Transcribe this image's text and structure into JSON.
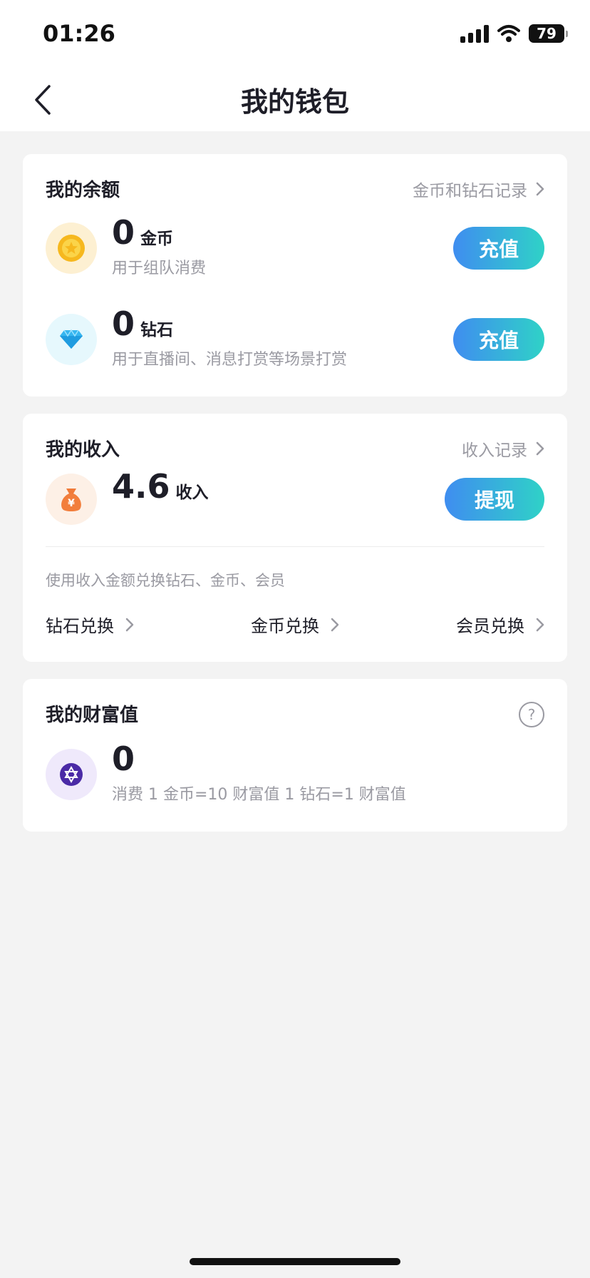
{
  "status_bar": {
    "time": "01:26",
    "battery": "79"
  },
  "header": {
    "title": "我的钱包"
  },
  "balance": {
    "title": "我的余额",
    "record_link": "金币和钻石记录",
    "coin": {
      "amount": "0",
      "unit": "金币",
      "desc": "用于组队消费",
      "button": "充值"
    },
    "diamond": {
      "amount": "0",
      "unit": "钻石",
      "desc": "用于直播间、消息打赏等场景打赏",
      "button": "充值"
    }
  },
  "income": {
    "title": "我的收入",
    "record_link": "收入记录",
    "amount": "4.6",
    "unit": "收入",
    "button": "提现",
    "exchange_note": "使用收入金额兑换钻石、金币、会员",
    "exchange": [
      "钻石兑换",
      "金币兑换",
      "会员兑换"
    ]
  },
  "wealth": {
    "title": "我的财富值",
    "help_symbol": "?",
    "amount": "0",
    "desc": "消费 1 金币=10 财富值 1 钻石=1 财富值"
  },
  "colors": {
    "button_gradient_start": "#3f8df0",
    "button_gradient_end": "#2fd2c7",
    "muted_text": "#9a9aa2",
    "page_bg": "#f3f3f3"
  }
}
